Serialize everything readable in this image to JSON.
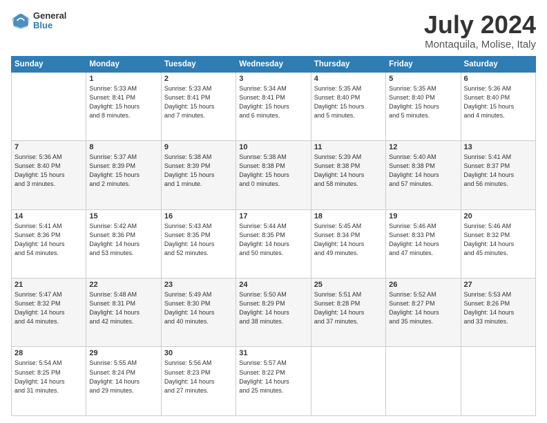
{
  "logo": {
    "line1": "General",
    "line2": "Blue"
  },
  "title": "July 2024",
  "subtitle": "Montaquila, Molise, Italy",
  "weekdays": [
    "Sunday",
    "Monday",
    "Tuesday",
    "Wednesday",
    "Thursday",
    "Friday",
    "Saturday"
  ],
  "weeks": [
    [
      {
        "day": "",
        "info": ""
      },
      {
        "day": "1",
        "info": "Sunrise: 5:33 AM\nSunset: 8:41 PM\nDaylight: 15 hours\nand 8 minutes."
      },
      {
        "day": "2",
        "info": "Sunrise: 5:33 AM\nSunset: 8:41 PM\nDaylight: 15 hours\nand 7 minutes."
      },
      {
        "day": "3",
        "info": "Sunrise: 5:34 AM\nSunset: 8:41 PM\nDaylight: 15 hours\nand 6 minutes."
      },
      {
        "day": "4",
        "info": "Sunrise: 5:35 AM\nSunset: 8:40 PM\nDaylight: 15 hours\nand 5 minutes."
      },
      {
        "day": "5",
        "info": "Sunrise: 5:35 AM\nSunset: 8:40 PM\nDaylight: 15 hours\nand 5 minutes."
      },
      {
        "day": "6",
        "info": "Sunrise: 5:36 AM\nSunset: 8:40 PM\nDaylight: 15 hours\nand 4 minutes."
      }
    ],
    [
      {
        "day": "7",
        "info": "Sunrise: 5:36 AM\nSunset: 8:40 PM\nDaylight: 15 hours\nand 3 minutes."
      },
      {
        "day": "8",
        "info": "Sunrise: 5:37 AM\nSunset: 8:39 PM\nDaylight: 15 hours\nand 2 minutes."
      },
      {
        "day": "9",
        "info": "Sunrise: 5:38 AM\nSunset: 8:39 PM\nDaylight: 15 hours\nand 1 minute."
      },
      {
        "day": "10",
        "info": "Sunrise: 5:38 AM\nSunset: 8:38 PM\nDaylight: 15 hours\nand 0 minutes."
      },
      {
        "day": "11",
        "info": "Sunrise: 5:39 AM\nSunset: 8:38 PM\nDaylight: 14 hours\nand 58 minutes."
      },
      {
        "day": "12",
        "info": "Sunrise: 5:40 AM\nSunset: 8:38 PM\nDaylight: 14 hours\nand 57 minutes."
      },
      {
        "day": "13",
        "info": "Sunrise: 5:41 AM\nSunset: 8:37 PM\nDaylight: 14 hours\nand 56 minutes."
      }
    ],
    [
      {
        "day": "14",
        "info": "Sunrise: 5:41 AM\nSunset: 8:36 PM\nDaylight: 14 hours\nand 54 minutes."
      },
      {
        "day": "15",
        "info": "Sunrise: 5:42 AM\nSunset: 8:36 PM\nDaylight: 14 hours\nand 53 minutes."
      },
      {
        "day": "16",
        "info": "Sunrise: 5:43 AM\nSunset: 8:35 PM\nDaylight: 14 hours\nand 52 minutes."
      },
      {
        "day": "17",
        "info": "Sunrise: 5:44 AM\nSunset: 8:35 PM\nDaylight: 14 hours\nand 50 minutes."
      },
      {
        "day": "18",
        "info": "Sunrise: 5:45 AM\nSunset: 8:34 PM\nDaylight: 14 hours\nand 49 minutes."
      },
      {
        "day": "19",
        "info": "Sunrise: 5:46 AM\nSunset: 8:33 PM\nDaylight: 14 hours\nand 47 minutes."
      },
      {
        "day": "20",
        "info": "Sunrise: 5:46 AM\nSunset: 8:32 PM\nDaylight: 14 hours\nand 45 minutes."
      }
    ],
    [
      {
        "day": "21",
        "info": "Sunrise: 5:47 AM\nSunset: 8:32 PM\nDaylight: 14 hours\nand 44 minutes."
      },
      {
        "day": "22",
        "info": "Sunrise: 5:48 AM\nSunset: 8:31 PM\nDaylight: 14 hours\nand 42 minutes."
      },
      {
        "day": "23",
        "info": "Sunrise: 5:49 AM\nSunset: 8:30 PM\nDaylight: 14 hours\nand 40 minutes."
      },
      {
        "day": "24",
        "info": "Sunrise: 5:50 AM\nSunset: 8:29 PM\nDaylight: 14 hours\nand 38 minutes."
      },
      {
        "day": "25",
        "info": "Sunrise: 5:51 AM\nSunset: 8:28 PM\nDaylight: 14 hours\nand 37 minutes."
      },
      {
        "day": "26",
        "info": "Sunrise: 5:52 AM\nSunset: 8:27 PM\nDaylight: 14 hours\nand 35 minutes."
      },
      {
        "day": "27",
        "info": "Sunrise: 5:53 AM\nSunset: 8:26 PM\nDaylight: 14 hours\nand 33 minutes."
      }
    ],
    [
      {
        "day": "28",
        "info": "Sunrise: 5:54 AM\nSunset: 8:25 PM\nDaylight: 14 hours\nand 31 minutes."
      },
      {
        "day": "29",
        "info": "Sunrise: 5:55 AM\nSunset: 8:24 PM\nDaylight: 14 hours\nand 29 minutes."
      },
      {
        "day": "30",
        "info": "Sunrise: 5:56 AM\nSunset: 8:23 PM\nDaylight: 14 hours\nand 27 minutes."
      },
      {
        "day": "31",
        "info": "Sunrise: 5:57 AM\nSunset: 8:22 PM\nDaylight: 14 hours\nand 25 minutes."
      },
      {
        "day": "",
        "info": ""
      },
      {
        "day": "",
        "info": ""
      },
      {
        "day": "",
        "info": ""
      }
    ]
  ]
}
